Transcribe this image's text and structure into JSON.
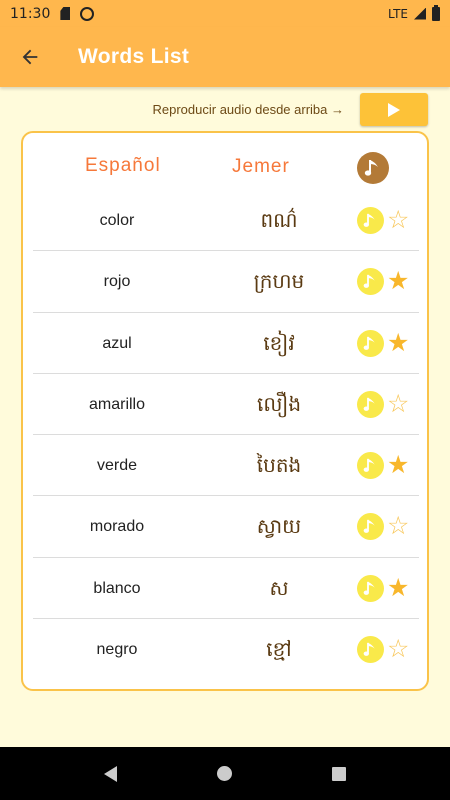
{
  "status": {
    "time": "11:30",
    "network": "LTE"
  },
  "appbar": {
    "title": "Words List"
  },
  "play": {
    "hint": "Reproducir audio desde arriba →"
  },
  "table": {
    "col_spanish": "Español",
    "col_khmer": "Jemer",
    "rows": [
      {
        "spanish": "color",
        "khmer": "ពណ៌",
        "starred": false
      },
      {
        "spanish": "rojo",
        "khmer": "ក្រហម",
        "starred": true
      },
      {
        "spanish": "azul",
        "khmer": "ខៀវ",
        "starred": true
      },
      {
        "spanish": "amarillo",
        "khmer": "លឿង",
        "starred": false
      },
      {
        "spanish": "verde",
        "khmer": "បៃតង",
        "starred": true
      },
      {
        "spanish": "morado",
        "khmer": "ស្វាយ",
        "starred": false
      },
      {
        "spanish": "blanco",
        "khmer": "ស",
        "starred": true
      },
      {
        "spanish": "negro",
        "khmer": "ខ្មៅ",
        "starred": false
      }
    ]
  },
  "colors": {
    "appbar": "#ffb74d",
    "accent": "#f6783a",
    "star": "#f8b72c",
    "audio": "#f9e94a",
    "card_border": "#fac349"
  },
  "icons": {
    "back": "arrow-left-icon",
    "play": "play-icon",
    "music": "music-note-icon",
    "star_filled": "star-filled-icon",
    "star_outline": "star-outline-icon"
  }
}
